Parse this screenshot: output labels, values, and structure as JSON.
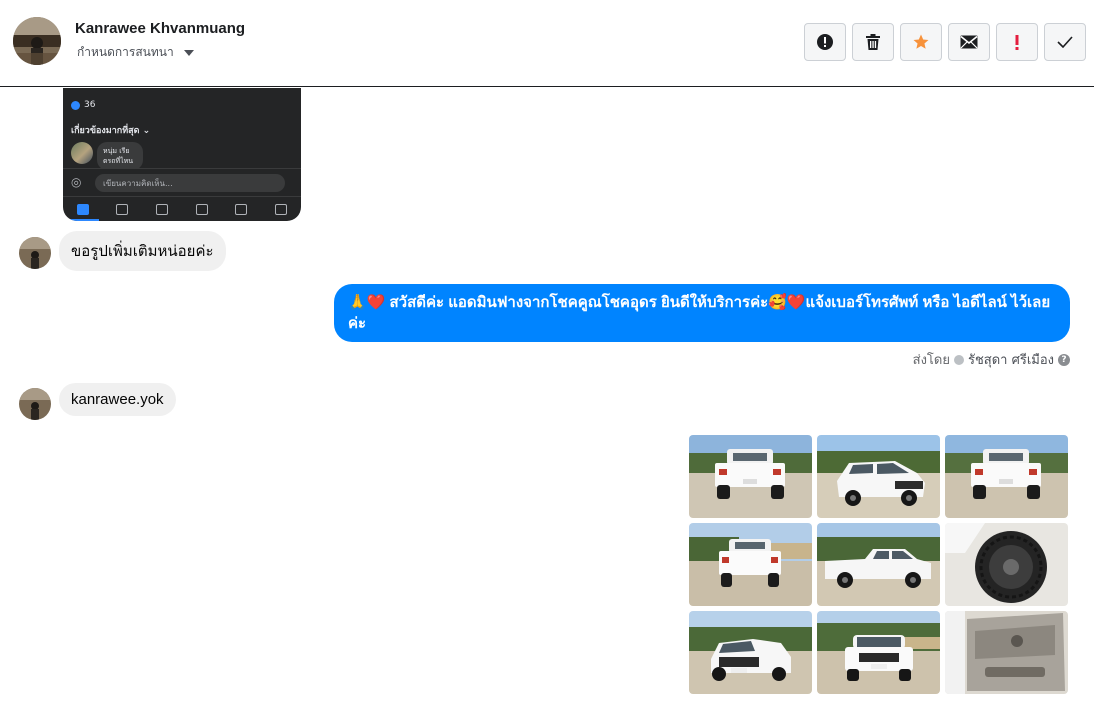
{
  "header": {
    "name": "Kanrawee Khvanmuang",
    "status_label": "กำหนดการสนทนา"
  },
  "toolbar": {
    "buttons": [
      {
        "name": "report-icon",
        "color": "#1c1e21"
      },
      {
        "name": "trash-icon",
        "color": "#1c1e21"
      },
      {
        "name": "star-icon",
        "color": "#f7923b"
      },
      {
        "name": "mail-icon",
        "color": "#1c1e21"
      },
      {
        "name": "important-icon",
        "color": "#e41e3f"
      },
      {
        "name": "check-icon",
        "color": "#1c1e21"
      }
    ]
  },
  "phone_screenshot": {
    "like_count": "36",
    "most_relevant": "เกี่ยวข้องมากที่สุด ⌄",
    "comment_author": "หนุ่ม เรีย",
    "comment_text": "ดรถที่ไหน",
    "compose_placeholder": "เขียนความคิดเห็น..."
  },
  "messages": [
    {
      "direction": "in",
      "text": "ขอรูปเพิ่มเติมหน่อยค่ะ"
    },
    {
      "direction": "out",
      "text": "🙏❤️ สวัสดีค่ะ แอดมินฟางจากโชคคูณโชคอุดร ยินดีให้บริการค่ะ🥰❤️แจ้งเบอร์โทรศัพท์ หรือ ไอดีไลน์  ไว้เลย ค่ะ",
      "sent_by_prefix": "ส่งโดย",
      "sent_by_agent": "รัชสุดา ศรีเมือง"
    },
    {
      "direction": "in",
      "text": "kanrawee.yok"
    }
  ],
  "photos": [
    {
      "name": "truck-rear-photo-1"
    },
    {
      "name": "truck-front-photo-1"
    },
    {
      "name": "truck-rear-photo-2"
    },
    {
      "name": "truck-rear-photo-3"
    },
    {
      "name": "truck-side-photo"
    },
    {
      "name": "truck-wheel-photo"
    },
    {
      "name": "truck-front-photo-2"
    },
    {
      "name": "truck-front-photo-3"
    },
    {
      "name": "truck-interior-door-photo"
    }
  ]
}
